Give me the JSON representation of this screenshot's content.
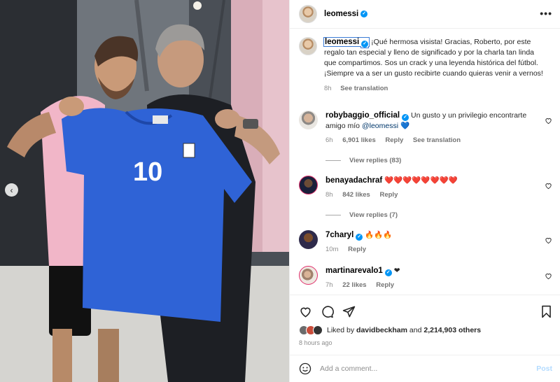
{
  "post": {
    "author": "leomessi",
    "photo_alt": "",
    "jersey_number": "10",
    "prev_icon": "chevron-left-icon",
    "more_icon": "more-horizontal-icon"
  },
  "caption": {
    "username": "leomessi",
    "text": "¡Qué hermosa visista! Gracias, Roberto, por este regalo tan especial y lleno de significado y por la charla tan linda que compartimos. Sos un crack y una leyenda histórica del fútbol. ¡Siempre va a ser un gusto recibirte cuando quieras venir a vernos!",
    "time": "8h",
    "translate": "See translation"
  },
  "comments": [
    {
      "username": "robybaggio_official",
      "verified": true,
      "text": "Un gusto y un privilegio encontrarte amigo mío",
      "mention": "@leomessi",
      "emoji": "💙",
      "time": "6h",
      "likes": "6,901 likes",
      "reply": "Reply",
      "translate": "See translation",
      "view_replies": "View replies (83)"
    },
    {
      "username": "benayadachraf",
      "verified": false,
      "text": "❤️❤️❤️❤️❤️❤️❤️❤️",
      "time": "8h",
      "likes": "842 likes",
      "reply": "Reply",
      "view_replies": "View replies (7)"
    },
    {
      "username": "7charyl",
      "verified": true,
      "text": "🔥🔥🔥",
      "time": "10m",
      "reply": "Reply"
    },
    {
      "username": "martinarevalo1",
      "verified": true,
      "text": "❤",
      "time": "7h",
      "likes": "22 likes",
      "reply": "Reply"
    }
  ],
  "actions": {
    "like_icon": "heart-icon",
    "comment_icon": "comment-icon",
    "share_icon": "share-icon",
    "save_icon": "bookmark-icon"
  },
  "liked_by": {
    "prefix": "Liked by",
    "user": "davidbeckham",
    "and": "and",
    "others": "2,214,903 others"
  },
  "posted_ago": "8 hours ago",
  "add_comment": {
    "placeholder": "Add a comment...",
    "post_label": "Post",
    "emoji_icon": "emoji-icon"
  },
  "colors": {
    "verified": "#0095f6",
    "post_disabled": "#b3dbff",
    "jersey": "#2f63d6",
    "mention": "#00376b"
  }
}
